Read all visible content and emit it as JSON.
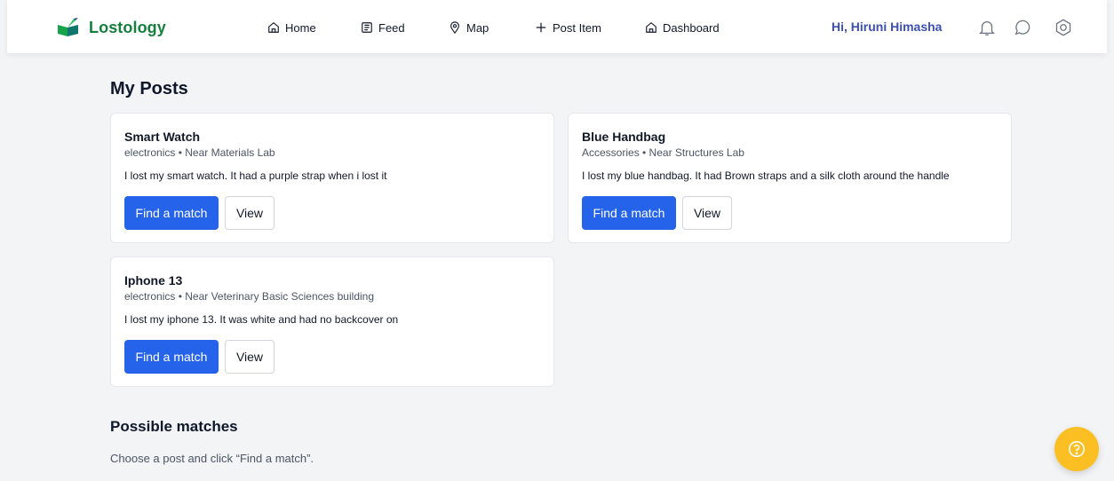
{
  "brand": {
    "name": "Lostology"
  },
  "nav": [
    {
      "label": "Home",
      "icon": "home-icon"
    },
    {
      "label": "Feed",
      "icon": "feed-icon"
    },
    {
      "label": "Map",
      "icon": "map-pin-icon"
    },
    {
      "label": "Post Item",
      "icon": "plus-icon"
    },
    {
      "label": "Dashboard",
      "icon": "home-icon"
    }
  ],
  "user": {
    "greeting": "Hi, Hiruni Himasha"
  },
  "header_icons": [
    "bell-icon",
    "chat-icon",
    "settings-icon"
  ],
  "main": {
    "title": "My Posts",
    "posts": [
      {
        "title": "Smart Watch",
        "meta": "electronics • Near Materials Lab",
        "description": "I lost my smart watch. It had a purple strap when i lost it",
        "primary_label": "Find a match",
        "secondary_label": "View"
      },
      {
        "title": "Blue Handbag",
        "meta": "Accessories • Near Structures Lab",
        "description": "I lost my blue handbag. It had Brown straps and a silk cloth around the handle",
        "primary_label": "Find a match",
        "secondary_label": "View"
      },
      {
        "title": "Iphone 13",
        "meta": "electronics • Near Veterinary Basic Sciences building",
        "description": "I lost my iphone 13. It was white and had no backcover on",
        "primary_label": "Find a match",
        "secondary_label": "View"
      }
    ]
  },
  "matches": {
    "title": "Possible matches",
    "hint": "Choose a post and click “Find a match”."
  },
  "colors": {
    "brand": "#15803d",
    "primary": "#2563eb",
    "greeting": "#3b4fb5",
    "help": "#fbbf24"
  }
}
